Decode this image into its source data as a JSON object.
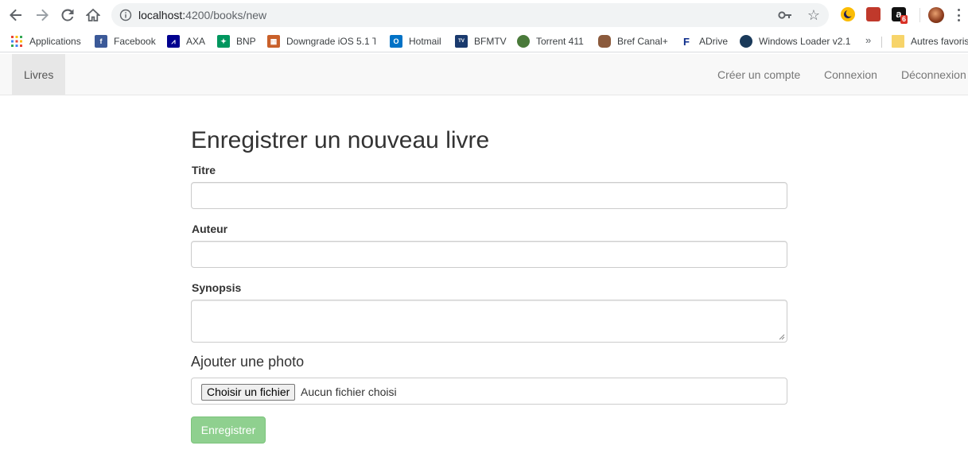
{
  "browser": {
    "url_host": "localhost:",
    "url_path": "4200/books/new",
    "extension_badge": "6"
  },
  "bookmarks": [
    {
      "label": "Applications",
      "icon": "apps-grid-icon",
      "color": "#e94235"
    },
    {
      "label": "Facebook",
      "icon": "facebook-icon",
      "color": "#3b5998"
    },
    {
      "label": "AXA",
      "icon": "axa-icon",
      "color": "#00008f"
    },
    {
      "label": "BNP",
      "icon": "bnp-icon",
      "color": "#00965e"
    },
    {
      "label": "Downgrade iOS 5.1 T",
      "icon": "brick-icon",
      "color": "#c9602a"
    },
    {
      "label": "Hotmail",
      "icon": "outlook-icon",
      "color": "#0072c6"
    },
    {
      "label": "BFMTV",
      "icon": "bfmtv-icon",
      "color": "#1a3a6e"
    },
    {
      "label": "Torrent 411",
      "icon": "torrent-icon",
      "color": "#4a7a3a"
    },
    {
      "label": "Bref Canal+",
      "icon": "bref-icon",
      "color": "#8b5a3c"
    },
    {
      "label": "ADrive",
      "icon": "adrive-icon",
      "color": "#0a2a8a"
    },
    {
      "label": "Windows Loader v2.1",
      "icon": "windows-loader-icon",
      "color": "#1a3a5a"
    }
  ],
  "bookmarks_more": "»",
  "bookmarks_other": "Autres favoris",
  "navbar": {
    "brand": "Livres",
    "items": [
      "Créer un compte",
      "Connexion",
      "Déconnexion"
    ]
  },
  "form": {
    "title": "Enregistrer un nouveau livre",
    "titre_label": "Titre",
    "titre_value": "",
    "auteur_label": "Auteur",
    "auteur_value": "",
    "synopsis_label": "Synopsis",
    "synopsis_value": "",
    "photo_label": "Ajouter une photo",
    "file_button": "Choisir un fichier",
    "file_status": "Aucun fichier choisi",
    "submit_label": "Enregistrer"
  },
  "colors": {
    "submit_bg": "#8fd08f",
    "navbar_bg": "#f8f8f8"
  }
}
